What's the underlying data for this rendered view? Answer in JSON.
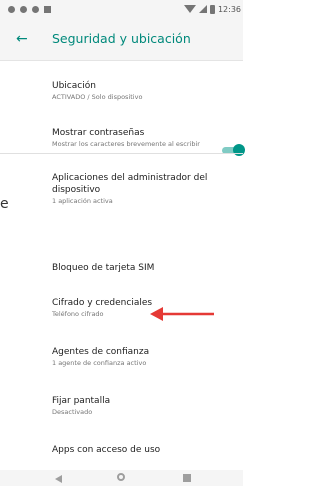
{
  "status_bar": {
    "time": "12:36"
  },
  "header": {
    "back_icon": "arrow-left-icon",
    "title": "Seguridad y ubicación"
  },
  "items": [
    {
      "title": "Ubicación",
      "subtitle": "ACTIVADO / Solo dispositivo"
    },
    {
      "title": "Mostrar contraseñas",
      "subtitle": "Mostrar los caracteres brevemente al escribir",
      "toggle": "on"
    },
    {
      "title": "Aplicaciones del administrador del dispositivo",
      "subtitle": "1 aplicación activa"
    },
    {
      "title": "Bloqueo de tarjeta SIM",
      "subtitle": ""
    },
    {
      "title": "Cifrado y credenciales",
      "subtitle": "Teléfono cifrado"
    },
    {
      "title": "Agentes de confianza",
      "subtitle": "1 agente de confianza activo"
    },
    {
      "title": "Fijar pantalla",
      "subtitle": "Desactivado"
    },
    {
      "title": "Apps con acceso de uso",
      "subtitle": ""
    }
  ],
  "edge_text": "e",
  "colors": {
    "accent": "#00897b",
    "toggle_thumb": "#009688",
    "toggle_track": "#80cbc4",
    "annotation_arrow": "#e53935"
  }
}
